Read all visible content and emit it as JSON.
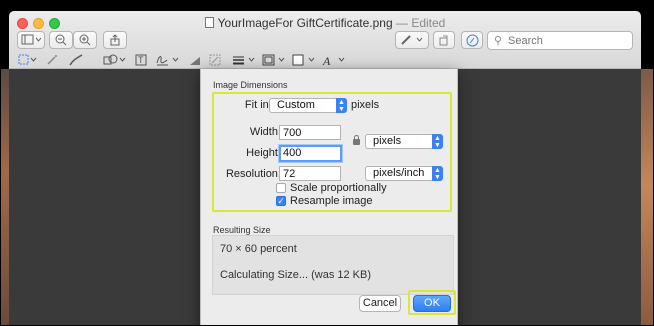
{
  "window": {
    "file_name": "YourImageFor GiftCertificate.png",
    "status": "— Edited"
  },
  "toolbar": {
    "search_placeholder": "Search"
  },
  "dialog": {
    "dimensions_header": "Image Dimensions",
    "fit_into_label": "Fit into:",
    "fit_into_value": "Custom",
    "fit_into_unit": "pixels",
    "width_label": "Width:",
    "width_value": "700",
    "height_label": "Height:",
    "height_value": "400",
    "size_unit": "pixels",
    "resolution_label": "Resolution:",
    "resolution_value": "72",
    "resolution_unit": "pixels/inch",
    "scale_label": "Scale proportionally",
    "scale_checked": false,
    "resample_label": "Resample image",
    "resample_checked": true,
    "result_header": "Resulting Size",
    "result_percent": "70 × 60 percent",
    "result_size": "Calculating Size... (was 12 KB)",
    "cancel_label": "Cancel",
    "ok_label": "OK"
  },
  "colors": {
    "accent": "#3b82f0",
    "highlight": "#d6e83a",
    "close": "#fc605c",
    "minimize": "#fdbc40",
    "maximize": "#34c84a"
  }
}
